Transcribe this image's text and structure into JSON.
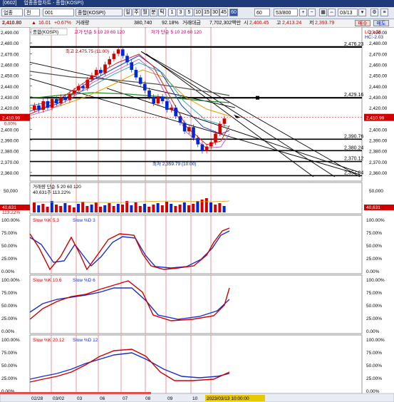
{
  "titlebar": {
    "code": "[0602]",
    "title": "업종종합차트 - 종합(KOSPI)"
  },
  "toolbar": {
    "market": "업종",
    "type": "전",
    "code": "001",
    "name": "종합(KOSPI)",
    "period_buttons": [
      "일",
      "주",
      "월",
      "분",
      "틱",
      "1",
      "3",
      "5",
      "10",
      "15",
      "30",
      "45",
      "60"
    ],
    "selected_period": "60",
    "count_value": "60",
    "range_value": "53/800",
    "date_value": "03/13"
  },
  "info": {
    "price": "2,410.80",
    "change_arrow": "▲",
    "change": "16.01",
    "change_pct": "+0.67%",
    "volume_label": "거래량",
    "volume": "380,740",
    "volume_pct": "92.18%",
    "amount_label": "거래대금",
    "amount": "7,702,302백만",
    "open_label": "시",
    "open": "2,400.45",
    "high_label": "고",
    "high": "2,413.24",
    "low_label": "저",
    "low": "2,393.79",
    "buy_label": "매수",
    "sell_label": "매도"
  },
  "price_panel": {
    "legend_name": "종합(KOSPI)",
    "ma_legend": "고가 단순 5 10 20 60 120",
    "ma2_legend": "저가 단순 5 10 20 60 120",
    "right_legend_1": "LC:1.78",
    "right_legend_2": "HC:-2.03",
    "current_tag": "2,410.99",
    "current_pct": "0.00%",
    "high_annotation": "최고 2,475.75 (11:00)",
    "low_annotation": "최저 2,359.79 (10:00)",
    "levels": [
      "2,476.23",
      "2,429.16",
      "2,390.76",
      "2,380.24",
      "2,370.12",
      "2,357.04"
    ],
    "y_ticks": [
      "2,490.00",
      "2,480.00",
      "2,470.00",
      "2,460.00",
      "2,450.00",
      "2,440.00",
      "2,430.00",
      "2,420.00",
      "2,410.00",
      "2,400.00",
      "2,390.00",
      "2,380.00",
      "2,370.00",
      "2,360.00"
    ]
  },
  "volume_panel": {
    "legend": "거래량 단순 5 20 60 120",
    "legend_value": "40,631주 113.22%",
    "tag_value": "40,631",
    "tag_pct": "113.22%",
    "y_ticks": [
      "50,000",
      "0"
    ]
  },
  "stoch1": {
    "legend_k": "Slow %K 5,3",
    "legend_d": "Slow %D 3",
    "y_ticks": [
      "100.00%",
      "75.00%",
      "50.00%",
      "25.00%",
      "0.00%"
    ]
  },
  "stoch2": {
    "legend_k": "Slow %K 10,6",
    "legend_d": "Slow %D 6",
    "y_ticks": [
      "100.00%",
      "75.00%",
      "50.00%",
      "25.00%",
      "0.00%"
    ]
  },
  "stoch3": {
    "legend_k": "Slow %K 20,12",
    "legend_d": "Slow %D 12",
    "y_ticks": [
      "100.00%",
      "75.00%",
      "50.00%",
      "25.00%",
      "0.00%"
    ]
  },
  "x_axis": {
    "labels": [
      "02/28",
      "03/02",
      "03",
      "06",
      "07",
      "08",
      "09",
      "10",
      "13"
    ],
    "last_tag": "2023/03/13 10:00:00"
  },
  "colors": {
    "up": "#d00000",
    "down": "#0026d6",
    "ma5": "#e02020",
    "ma10": "#1a40d0",
    "ma20": "#e0a000",
    "ma60": "#2a8a2a",
    "ma120": "#505050",
    "k_line": "#d00000",
    "d_line": "#1a2fc8"
  }
}
